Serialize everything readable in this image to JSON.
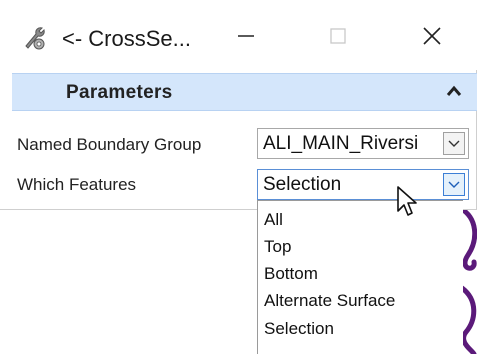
{
  "window": {
    "title": "<- CrossSe...",
    "icon": "tool-wrench-gear-icon",
    "buttons": [
      "minimize-icon",
      "maximize-icon",
      "close-icon"
    ]
  },
  "panel": {
    "section_title": "Parameters",
    "section_state_icon": "chevron-up-icon",
    "fields": [
      {
        "label": "Named Boundary Group",
        "value": "ALI_MAIN_Riversi"
      },
      {
        "label": "Which Features",
        "value": "Selection"
      }
    ]
  },
  "dropdown": {
    "options": [
      "All",
      "Top",
      "Bottom",
      "Alternate Surface",
      "Selection"
    ]
  },
  "colors": {
    "section_header_bg": "#d4e6fb",
    "focus_border": "#5a8fd6",
    "background_stroke": "#5b1a7a"
  }
}
